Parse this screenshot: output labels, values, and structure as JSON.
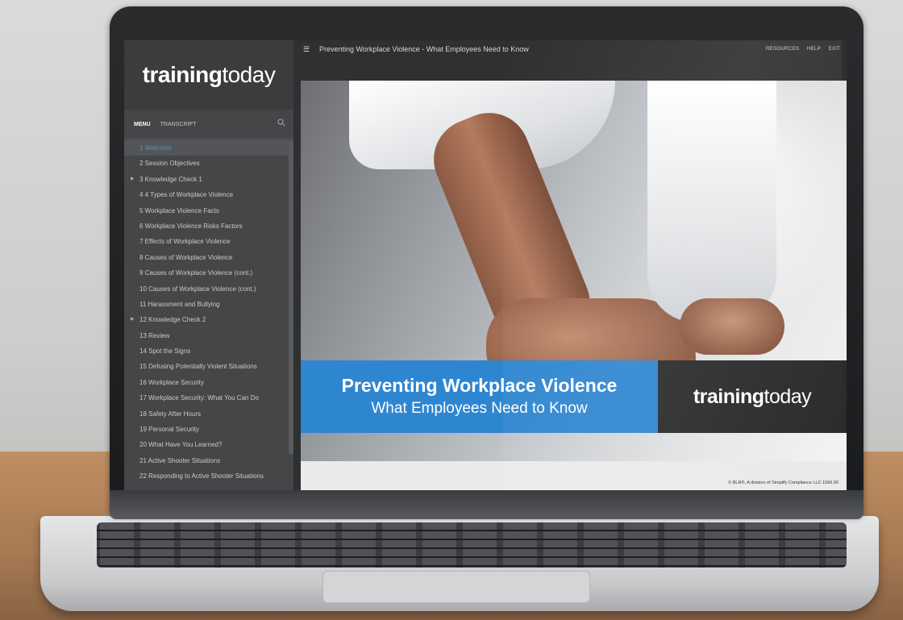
{
  "brand": {
    "bold": "training",
    "light": "today"
  },
  "sidebar": {
    "tabs": [
      {
        "label": "MENU"
      },
      {
        "label": "TRANSCRIPT"
      }
    ],
    "items": [
      {
        "label": "1  Welcome"
      },
      {
        "label": "2  Session Objectives"
      },
      {
        "label": "3  Knowledge Check 1"
      },
      {
        "label": "4  4 Types of Workplace Violence"
      },
      {
        "label": "5  Workplace Violence Facts"
      },
      {
        "label": "6  Workplace Violence Risks Factors"
      },
      {
        "label": "7  Effects of Workplace Violence"
      },
      {
        "label": "8  Causes of Workplace Violence"
      },
      {
        "label": "9  Causes of Workplace Violence (cont.)"
      },
      {
        "label": "10  Causes of Workplace Violence (cont.)"
      },
      {
        "label": "11  Harassment and Bullying"
      },
      {
        "label": "12  Knowledge Check 2"
      },
      {
        "label": "13  Review"
      },
      {
        "label": "14  Spot the Signs"
      },
      {
        "label": "15  Defusing Potentially Violent Situations"
      },
      {
        "label": "16  Workplace Security"
      },
      {
        "label": "17  Workplace Security: What You Can Do"
      },
      {
        "label": "18  Safety After Hours"
      },
      {
        "label": "19  Personal Security"
      },
      {
        "label": "20  What Have You Learned?"
      },
      {
        "label": "21  Active Shooter Situations"
      },
      {
        "label": "22  Responding to Active Shooter Situations"
      }
    ]
  },
  "topbar": {
    "title": "Preventing Workplace Violence - What Employees Need to Know",
    "links": [
      "RESOURCES",
      "HELP",
      "EXIT"
    ]
  },
  "slide": {
    "title": "Preventing Workplace Violence",
    "subtitle": "What Employees Need to Know",
    "copyright": "© BLR®, A division of Simplify Compliance LLC 1566.00"
  },
  "colors": {
    "accent": "#2f86d0",
    "active_item": "#3a9ad9"
  }
}
